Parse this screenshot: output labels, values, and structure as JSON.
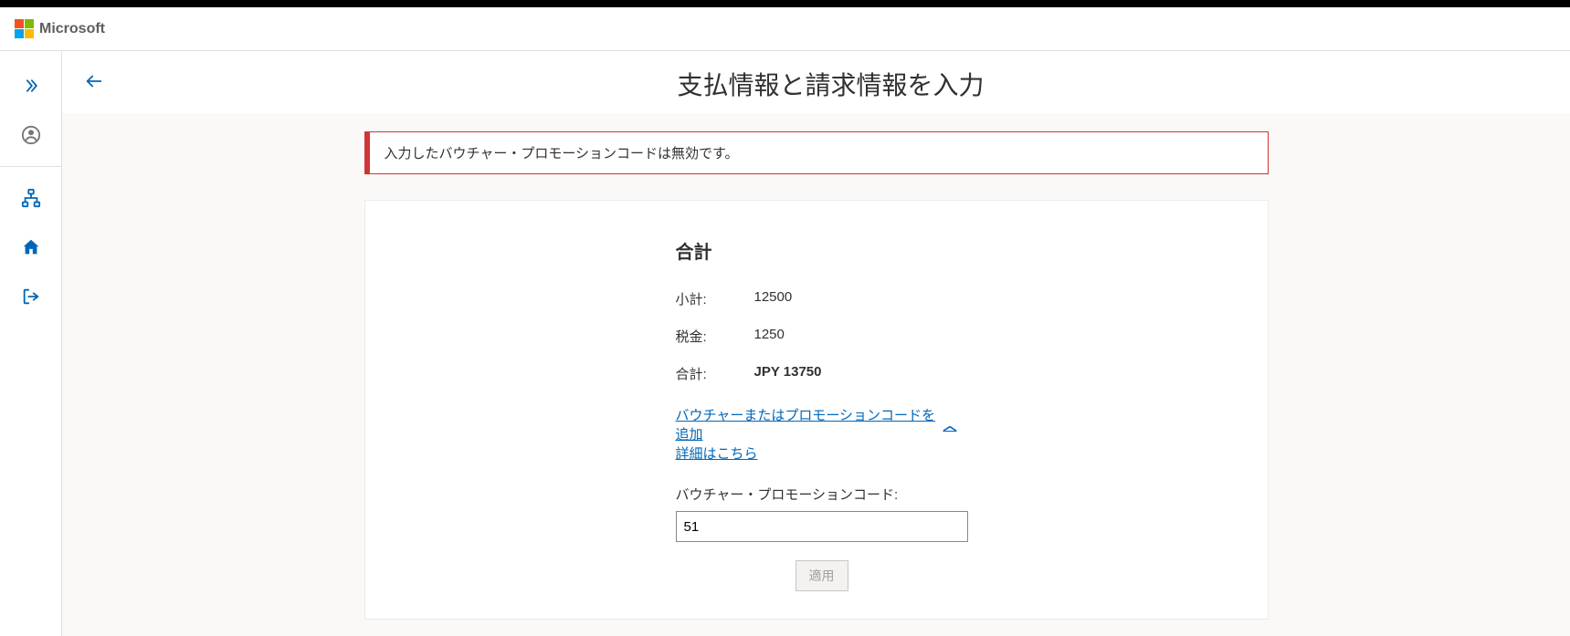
{
  "header": {
    "brand": "Microsoft"
  },
  "page": {
    "title": "支払情報と請求情報を入力"
  },
  "error": {
    "message": "入力したバウチャー・プロモーションコードは無効です。"
  },
  "totals": {
    "heading": "合計",
    "subtotal_label": "小計:",
    "subtotal_value": "12500",
    "tax_label": "税金:",
    "tax_value": "1250",
    "total_label": "合計:",
    "total_currency": "JPY",
    "total_value": "13750"
  },
  "voucher": {
    "add_link": "バウチャーまたはプロモーションコードを追加",
    "detail_link": "詳細はこちら",
    "field_label": "バウチャー・プロモーションコード:",
    "input_value": "51",
    "apply_label": "適用"
  }
}
